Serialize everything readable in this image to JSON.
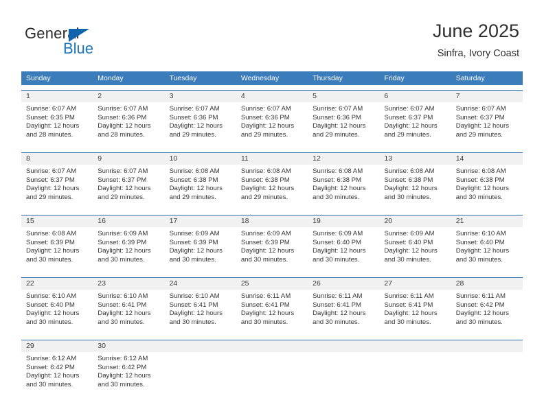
{
  "brand": {
    "name_top": "General",
    "name_bottom": "Blue",
    "triangle_color": "#1263ad",
    "blue_color": "#1b75bb"
  },
  "header": {
    "title": "June 2025",
    "location": "Sinfra, Ivory Coast"
  },
  "theme": {
    "header_blue": "#3b7cba",
    "row_rule": "#2e6fae",
    "daynum_band": "#f1f1f1",
    "text": "#333333"
  },
  "weekdays": [
    "Sunday",
    "Monday",
    "Tuesday",
    "Wednesday",
    "Thursday",
    "Friday",
    "Saturday"
  ],
  "weeks": [
    {
      "days": [
        {
          "num": "1",
          "sunrise": "Sunrise: 6:07 AM",
          "sunset": "Sunset: 6:35 PM",
          "daylight1": "Daylight: 12 hours",
          "daylight2": "and 28 minutes."
        },
        {
          "num": "2",
          "sunrise": "Sunrise: 6:07 AM",
          "sunset": "Sunset: 6:36 PM",
          "daylight1": "Daylight: 12 hours",
          "daylight2": "and 28 minutes."
        },
        {
          "num": "3",
          "sunrise": "Sunrise: 6:07 AM",
          "sunset": "Sunset: 6:36 PM",
          "daylight1": "Daylight: 12 hours",
          "daylight2": "and 29 minutes."
        },
        {
          "num": "4",
          "sunrise": "Sunrise: 6:07 AM",
          "sunset": "Sunset: 6:36 PM",
          "daylight1": "Daylight: 12 hours",
          "daylight2": "and 29 minutes."
        },
        {
          "num": "5",
          "sunrise": "Sunrise: 6:07 AM",
          "sunset": "Sunset: 6:36 PM",
          "daylight1": "Daylight: 12 hours",
          "daylight2": "and 29 minutes."
        },
        {
          "num": "6",
          "sunrise": "Sunrise: 6:07 AM",
          "sunset": "Sunset: 6:37 PM",
          "daylight1": "Daylight: 12 hours",
          "daylight2": "and 29 minutes."
        },
        {
          "num": "7",
          "sunrise": "Sunrise: 6:07 AM",
          "sunset": "Sunset: 6:37 PM",
          "daylight1": "Daylight: 12 hours",
          "daylight2": "and 29 minutes."
        }
      ]
    },
    {
      "days": [
        {
          "num": "8",
          "sunrise": "Sunrise: 6:07 AM",
          "sunset": "Sunset: 6:37 PM",
          "daylight1": "Daylight: 12 hours",
          "daylight2": "and 29 minutes."
        },
        {
          "num": "9",
          "sunrise": "Sunrise: 6:07 AM",
          "sunset": "Sunset: 6:37 PM",
          "daylight1": "Daylight: 12 hours",
          "daylight2": "and 29 minutes."
        },
        {
          "num": "10",
          "sunrise": "Sunrise: 6:08 AM",
          "sunset": "Sunset: 6:38 PM",
          "daylight1": "Daylight: 12 hours",
          "daylight2": "and 29 minutes."
        },
        {
          "num": "11",
          "sunrise": "Sunrise: 6:08 AM",
          "sunset": "Sunset: 6:38 PM",
          "daylight1": "Daylight: 12 hours",
          "daylight2": "and 29 minutes."
        },
        {
          "num": "12",
          "sunrise": "Sunrise: 6:08 AM",
          "sunset": "Sunset: 6:38 PM",
          "daylight1": "Daylight: 12 hours",
          "daylight2": "and 30 minutes."
        },
        {
          "num": "13",
          "sunrise": "Sunrise: 6:08 AM",
          "sunset": "Sunset: 6:38 PM",
          "daylight1": "Daylight: 12 hours",
          "daylight2": "and 30 minutes."
        },
        {
          "num": "14",
          "sunrise": "Sunrise: 6:08 AM",
          "sunset": "Sunset: 6:38 PM",
          "daylight1": "Daylight: 12 hours",
          "daylight2": "and 30 minutes."
        }
      ]
    },
    {
      "days": [
        {
          "num": "15",
          "sunrise": "Sunrise: 6:08 AM",
          "sunset": "Sunset: 6:39 PM",
          "daylight1": "Daylight: 12 hours",
          "daylight2": "and 30 minutes."
        },
        {
          "num": "16",
          "sunrise": "Sunrise: 6:09 AM",
          "sunset": "Sunset: 6:39 PM",
          "daylight1": "Daylight: 12 hours",
          "daylight2": "and 30 minutes."
        },
        {
          "num": "17",
          "sunrise": "Sunrise: 6:09 AM",
          "sunset": "Sunset: 6:39 PM",
          "daylight1": "Daylight: 12 hours",
          "daylight2": "and 30 minutes."
        },
        {
          "num": "18",
          "sunrise": "Sunrise: 6:09 AM",
          "sunset": "Sunset: 6:39 PM",
          "daylight1": "Daylight: 12 hours",
          "daylight2": "and 30 minutes."
        },
        {
          "num": "19",
          "sunrise": "Sunrise: 6:09 AM",
          "sunset": "Sunset: 6:40 PM",
          "daylight1": "Daylight: 12 hours",
          "daylight2": "and 30 minutes."
        },
        {
          "num": "20",
          "sunrise": "Sunrise: 6:09 AM",
          "sunset": "Sunset: 6:40 PM",
          "daylight1": "Daylight: 12 hours",
          "daylight2": "and 30 minutes."
        },
        {
          "num": "21",
          "sunrise": "Sunrise: 6:10 AM",
          "sunset": "Sunset: 6:40 PM",
          "daylight1": "Daylight: 12 hours",
          "daylight2": "and 30 minutes."
        }
      ]
    },
    {
      "days": [
        {
          "num": "22",
          "sunrise": "Sunrise: 6:10 AM",
          "sunset": "Sunset: 6:40 PM",
          "daylight1": "Daylight: 12 hours",
          "daylight2": "and 30 minutes."
        },
        {
          "num": "23",
          "sunrise": "Sunrise: 6:10 AM",
          "sunset": "Sunset: 6:41 PM",
          "daylight1": "Daylight: 12 hours",
          "daylight2": "and 30 minutes."
        },
        {
          "num": "24",
          "sunrise": "Sunrise: 6:10 AM",
          "sunset": "Sunset: 6:41 PM",
          "daylight1": "Daylight: 12 hours",
          "daylight2": "and 30 minutes."
        },
        {
          "num": "25",
          "sunrise": "Sunrise: 6:11 AM",
          "sunset": "Sunset: 6:41 PM",
          "daylight1": "Daylight: 12 hours",
          "daylight2": "and 30 minutes."
        },
        {
          "num": "26",
          "sunrise": "Sunrise: 6:11 AM",
          "sunset": "Sunset: 6:41 PM",
          "daylight1": "Daylight: 12 hours",
          "daylight2": "and 30 minutes."
        },
        {
          "num": "27",
          "sunrise": "Sunrise: 6:11 AM",
          "sunset": "Sunset: 6:41 PM",
          "daylight1": "Daylight: 12 hours",
          "daylight2": "and 30 minutes."
        },
        {
          "num": "28",
          "sunrise": "Sunrise: 6:11 AM",
          "sunset": "Sunset: 6:42 PM",
          "daylight1": "Daylight: 12 hours",
          "daylight2": "and 30 minutes."
        }
      ]
    },
    {
      "days": [
        {
          "num": "29",
          "sunrise": "Sunrise: 6:12 AM",
          "sunset": "Sunset: 6:42 PM",
          "daylight1": "Daylight: 12 hours",
          "daylight2": "and 30 minutes."
        },
        {
          "num": "30",
          "sunrise": "Sunrise: 6:12 AM",
          "sunset": "Sunset: 6:42 PM",
          "daylight1": "Daylight: 12 hours",
          "daylight2": "and 30 minutes."
        },
        {
          "num": "",
          "sunrise": "",
          "sunset": "",
          "daylight1": "",
          "daylight2": ""
        },
        {
          "num": "",
          "sunrise": "",
          "sunset": "",
          "daylight1": "",
          "daylight2": ""
        },
        {
          "num": "",
          "sunrise": "",
          "sunset": "",
          "daylight1": "",
          "daylight2": ""
        },
        {
          "num": "",
          "sunrise": "",
          "sunset": "",
          "daylight1": "",
          "daylight2": ""
        },
        {
          "num": "",
          "sunrise": "",
          "sunset": "",
          "daylight1": "",
          "daylight2": ""
        }
      ]
    }
  ]
}
